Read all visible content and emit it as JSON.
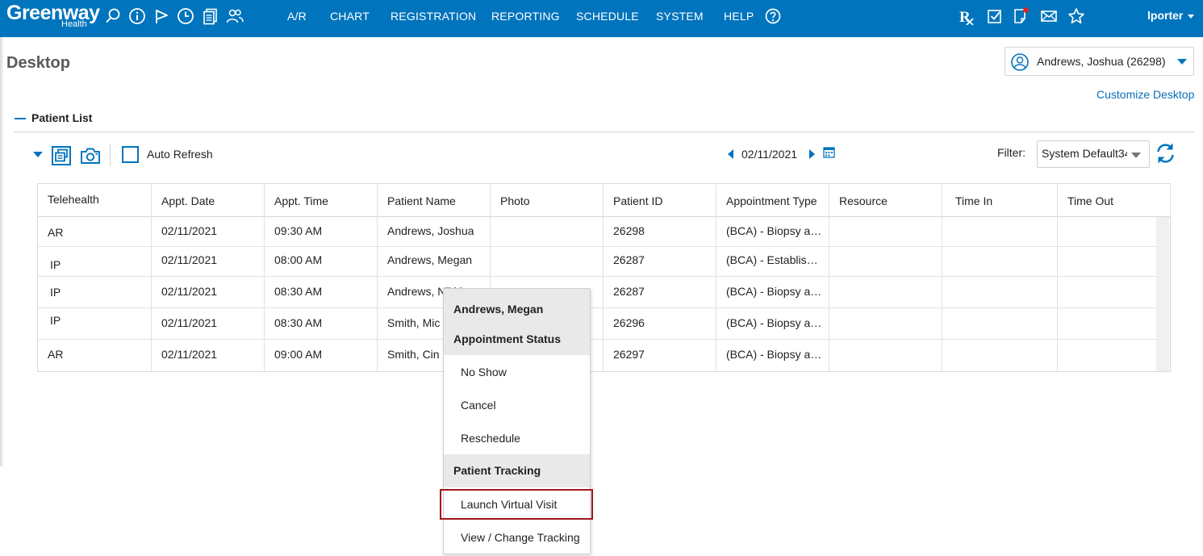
{
  "topbar": {
    "logo_main": "Greenway",
    "logo_sub": "Health",
    "tool_icons": [
      "search-icon",
      "info-icon",
      "flag-icon",
      "clock-icon",
      "documents-icon",
      "users-icon"
    ],
    "nav": [
      "A/R",
      "CHART",
      "REGISTRATION",
      "REPORTING",
      "SCHEDULE",
      "SYSTEM",
      "HELP"
    ],
    "help_icon": "question-circle-icon",
    "right_icons": [
      "rx-icon",
      "checkbox-task-icon",
      "note-alert-icon",
      "mail-icon",
      "star-icon"
    ],
    "user": "lporter",
    "brand_color": "#0074bd"
  },
  "page": {
    "title": "Desktop",
    "patient_selector": "Andrews, Joshua  (26298)",
    "customize_link": "Customize Desktop"
  },
  "patient_list": {
    "section_title": "Patient List",
    "auto_refresh_label": "Auto Refresh",
    "date": "02/11/2021",
    "filter_label": "Filter:",
    "filter_value": "System Default34",
    "columns": [
      "Telehealth",
      "Appt. Date",
      "Appt. Time",
      "Patient Name",
      "Photo",
      "Patient ID",
      "Appointment Type",
      "Resource",
      "Time In",
      "Time Out"
    ],
    "rows": [
      [
        "AR",
        "02/11/2021",
        "09:30 AM",
        "Andrews, Joshua",
        "",
        "26298",
        "(BCA) - Biopsy a…",
        "",
        "",
        ""
      ],
      [
        "IP",
        "02/11/2021",
        "08:00 AM",
        "Andrews, Megan",
        "",
        "26287",
        "(BCA) - Establis…",
        "",
        "",
        ""
      ],
      [
        "IP",
        "02/11/2021",
        "08:30 AM",
        "Andrews, Nikki",
        "",
        "26287",
        "(BCA) - Biopsy a…",
        "",
        "",
        ""
      ],
      [
        "IP",
        "02/11/2021",
        "08:30 AM",
        "Smith, Mic",
        "",
        "26296",
        "(BCA) - Biopsy a…",
        "",
        "",
        ""
      ],
      [
        "AR",
        "02/11/2021",
        "09:00 AM",
        "Smith, Cin",
        "",
        "26297",
        "(BCA) - Biopsy a…",
        "",
        "",
        ""
      ]
    ]
  },
  "context_menu": {
    "patient": "Andrews, Megan",
    "group1": "Appointment Status",
    "group1_items": [
      "No Show",
      "Cancel",
      "Reschedule"
    ],
    "group2": "Patient Tracking",
    "group2_items": [
      "Launch Virtual Visit",
      "View / Change Tracking"
    ],
    "highlight_color": "#a3171d"
  }
}
